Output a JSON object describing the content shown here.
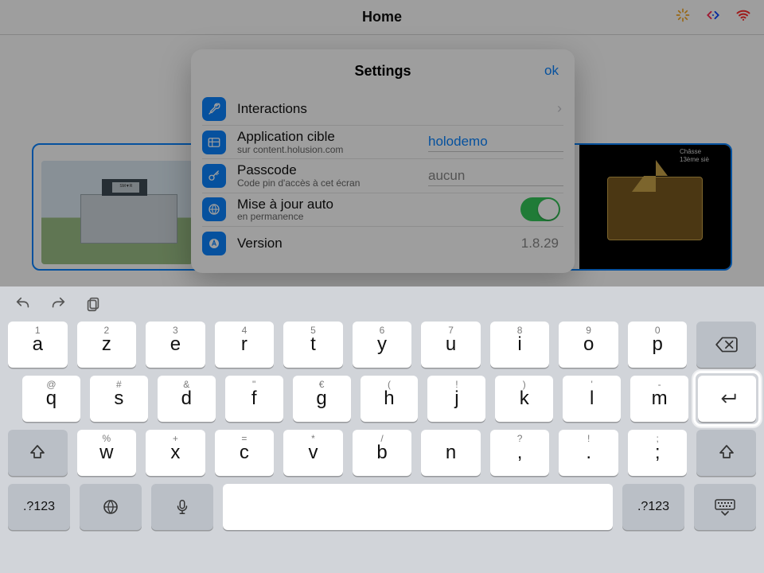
{
  "statusbar": {
    "title": "Home"
  },
  "panel": {
    "title": "Settings",
    "ok_label": "ok",
    "rows": {
      "interactions": {
        "label": "Interactions"
      },
      "app_target": {
        "label": "Application cible",
        "sub": "sur content.holusion.com",
        "value": "holodemo"
      },
      "passcode": {
        "label": "Passcode",
        "sub": "Code pin d'accès à cet écran",
        "value": "",
        "placeholder": "aucun"
      },
      "auto_update": {
        "label": "Mise à jour auto",
        "sub": "en permanence",
        "on": true
      },
      "version": {
        "label": "Version",
        "value": "1.8.29"
      }
    }
  },
  "cards": {
    "right_caption_top": "Châsse",
    "right_caption_sub": "13ème siè"
  },
  "keyboard": {
    "layout": "azerty",
    "numLabel": ".?123",
    "row1": [
      {
        "sup": "1",
        "main": "a"
      },
      {
        "sup": "2",
        "main": "z"
      },
      {
        "sup": "3",
        "main": "e"
      },
      {
        "sup": "4",
        "main": "r"
      },
      {
        "sup": "5",
        "main": "t"
      },
      {
        "sup": "6",
        "main": "y"
      },
      {
        "sup": "7",
        "main": "u"
      },
      {
        "sup": "8",
        "main": "i"
      },
      {
        "sup": "9",
        "main": "o"
      },
      {
        "sup": "0",
        "main": "p"
      }
    ],
    "row2": [
      {
        "sup": "@",
        "main": "q"
      },
      {
        "sup": "#",
        "main": "s"
      },
      {
        "sup": "&",
        "main": "d"
      },
      {
        "sup": "\"",
        "main": "f"
      },
      {
        "sup": "€",
        "main": "g"
      },
      {
        "sup": "(",
        "main": "h"
      },
      {
        "sup": "!",
        "main": "j"
      },
      {
        "sup": ")",
        "main": "k"
      },
      {
        "sup": "'",
        "main": "l"
      },
      {
        "sup": "-",
        "main": "m"
      }
    ],
    "row3": [
      {
        "sup": "%",
        "main": "w"
      },
      {
        "sup": "+",
        "main": "x"
      },
      {
        "sup": "=",
        "main": "c"
      },
      {
        "sup": "*",
        "main": "v"
      },
      {
        "sup": "/",
        "main": "b"
      },
      {
        "sup": "",
        "main": "n"
      },
      {
        "sup": "?",
        "main": ","
      },
      {
        "sup": "!",
        "main": "."
      },
      {
        "sup": ";",
        "main": ";"
      }
    ]
  }
}
